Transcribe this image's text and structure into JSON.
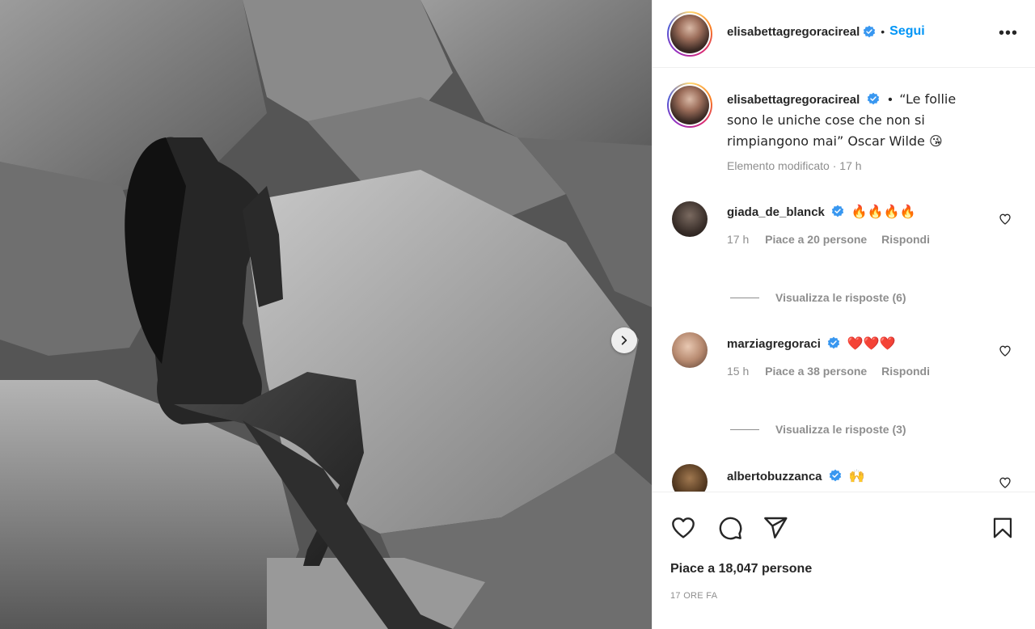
{
  "post": {
    "username": "elisabettagregoracireal",
    "follow_label": "Segui",
    "more_label": "•••",
    "caption_separator": "•",
    "caption": "“Le follie sono le uniche cose che non si rimpiangono mai” Oscar Wilde 😘",
    "caption_meta": "Elemento modificato · 17 h",
    "likes": "Piace a 18,047 persone",
    "time_ago": "17 ORE FA"
  },
  "comments": [
    {
      "username": "giada_de_blanck",
      "text": "🔥🔥🔥🔥",
      "time": "17 h",
      "likes": "Piace a 20 persone",
      "reply": "Rispondi",
      "view_replies": "Visualizza le risposte (6)"
    },
    {
      "username": "marziagregoraci",
      "text": "❤️❤️❤️",
      "time": "15 h",
      "likes": "Piace a 38 persone",
      "reply": "Rispondi",
      "view_replies": "Visualizza le risposte (3)"
    },
    {
      "username": "albertobuzzanca",
      "text": "🙌"
    }
  ],
  "icons": {
    "like": "heart-icon",
    "comment": "comment-icon",
    "share": "share-icon",
    "save": "bookmark-icon",
    "next": "chevron-right-icon",
    "verified": "verified-badge-icon"
  },
  "colors": {
    "accent": "#0095f6",
    "verified": "#3897f0",
    "muted": "#8e8e8e",
    "text": "#262626"
  }
}
